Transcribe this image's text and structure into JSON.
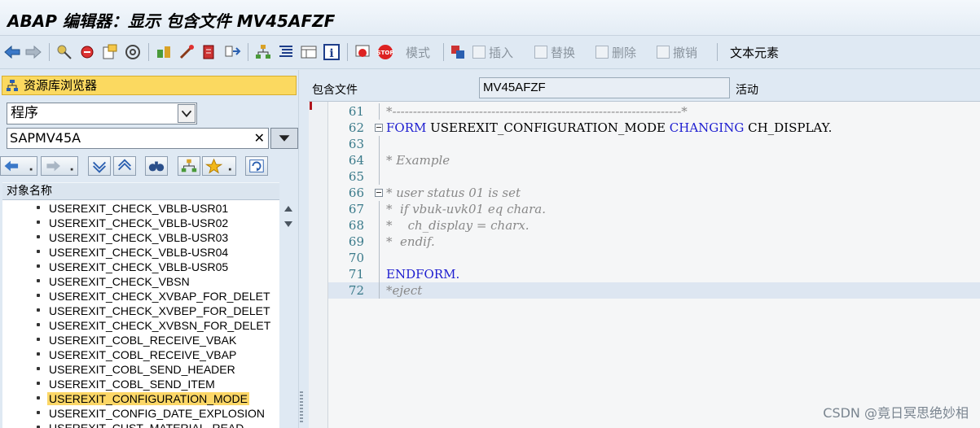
{
  "window": {
    "title": "ABAP 编辑器：显示 包含文件 MV45AFZF"
  },
  "toolbar": {
    "pattern_label": "模式",
    "insert_label": "插入",
    "replace_label": "替换",
    "delete_label": "删除",
    "undo_label": "撤销",
    "text_elements_label": "文本元素"
  },
  "left_pane": {
    "header": "资源库浏览器",
    "object_type": "程序",
    "object_name": "SAPMV45A",
    "clear_glyph": "✕",
    "column_header": "对象名称",
    "items": [
      {
        "label": "USEREXIT_CHECK_VBLB-USR01"
      },
      {
        "label": "USEREXIT_CHECK_VBLB-USR02"
      },
      {
        "label": "USEREXIT_CHECK_VBLB-USR03"
      },
      {
        "label": "USEREXIT_CHECK_VBLB-USR04"
      },
      {
        "label": "USEREXIT_CHECK_VBLB-USR05"
      },
      {
        "label": "USEREXIT_CHECK_VBSN"
      },
      {
        "label": "USEREXIT_CHECK_XVBAP_FOR_DELET"
      },
      {
        "label": "USEREXIT_CHECK_XVBEP_FOR_DELET"
      },
      {
        "label": "USEREXIT_CHECK_XVBSN_FOR_DELET"
      },
      {
        "label": "USEREXIT_COBL_RECEIVE_VBAK"
      },
      {
        "label": "USEREXIT_COBL_RECEIVE_VBAP"
      },
      {
        "label": "USEREXIT_COBL_SEND_HEADER"
      },
      {
        "label": "USEREXIT_COBL_SEND_ITEM"
      },
      {
        "label": "USEREXIT_CONFIGURATION_MODE",
        "selected": true
      },
      {
        "label": "USEREXIT_CONFIG_DATE_EXPLOSION"
      },
      {
        "label": "USEREXIT_CUST_MATERIAL_READ"
      }
    ]
  },
  "editor": {
    "include_label": "包含文件",
    "include_name": "MV45AFZF",
    "status": "活动",
    "lines": [
      {
        "no": "61",
        "parts": [
          {
            "t": "*----------------------------------------------------------------------*",
            "c": "cmt"
          }
        ]
      },
      {
        "no": "62",
        "fold": true,
        "parts": [
          {
            "t": "FORM ",
            "c": "kw"
          },
          {
            "t": "USEREXIT_CONFIGURATION_MODE ",
            "c": "plain"
          },
          {
            "t": "CHANGING ",
            "c": "kw"
          },
          {
            "t": "CH_DISPLAY.",
            "c": "plain"
          }
        ]
      },
      {
        "no": "63",
        "parts": []
      },
      {
        "no": "64",
        "parts": [
          {
            "t": "* Example",
            "c": "cmt"
          }
        ]
      },
      {
        "no": "65",
        "parts": []
      },
      {
        "no": "66",
        "fold": true,
        "parts": [
          {
            "t": "* user status 01 is set",
            "c": "cmt"
          }
        ]
      },
      {
        "no": "67",
        "parts": [
          {
            "t": "*  if vbuk-uvk01 eq chara.",
            "c": "cmt"
          }
        ]
      },
      {
        "no": "68",
        "parts": [
          {
            "t": "*    ch_display = charx.",
            "c": "cmt"
          }
        ]
      },
      {
        "no": "69",
        "parts": [
          {
            "t": "*  endif.",
            "c": "cmt"
          }
        ]
      },
      {
        "no": "70",
        "parts": []
      },
      {
        "no": "71",
        "parts": [
          {
            "t": "ENDFORM.",
            "c": "kw"
          }
        ]
      },
      {
        "no": "72",
        "current": true,
        "parts": [
          {
            "t": "*eject",
            "c": "cmt"
          }
        ]
      }
    ]
  },
  "watermark": "CSDN @竟日冥思绝妙相",
  "colors": {
    "keyword": "#1d1dd0",
    "comment": "#888888",
    "selection": "#fcd767",
    "header_bg": "#fbd960"
  }
}
